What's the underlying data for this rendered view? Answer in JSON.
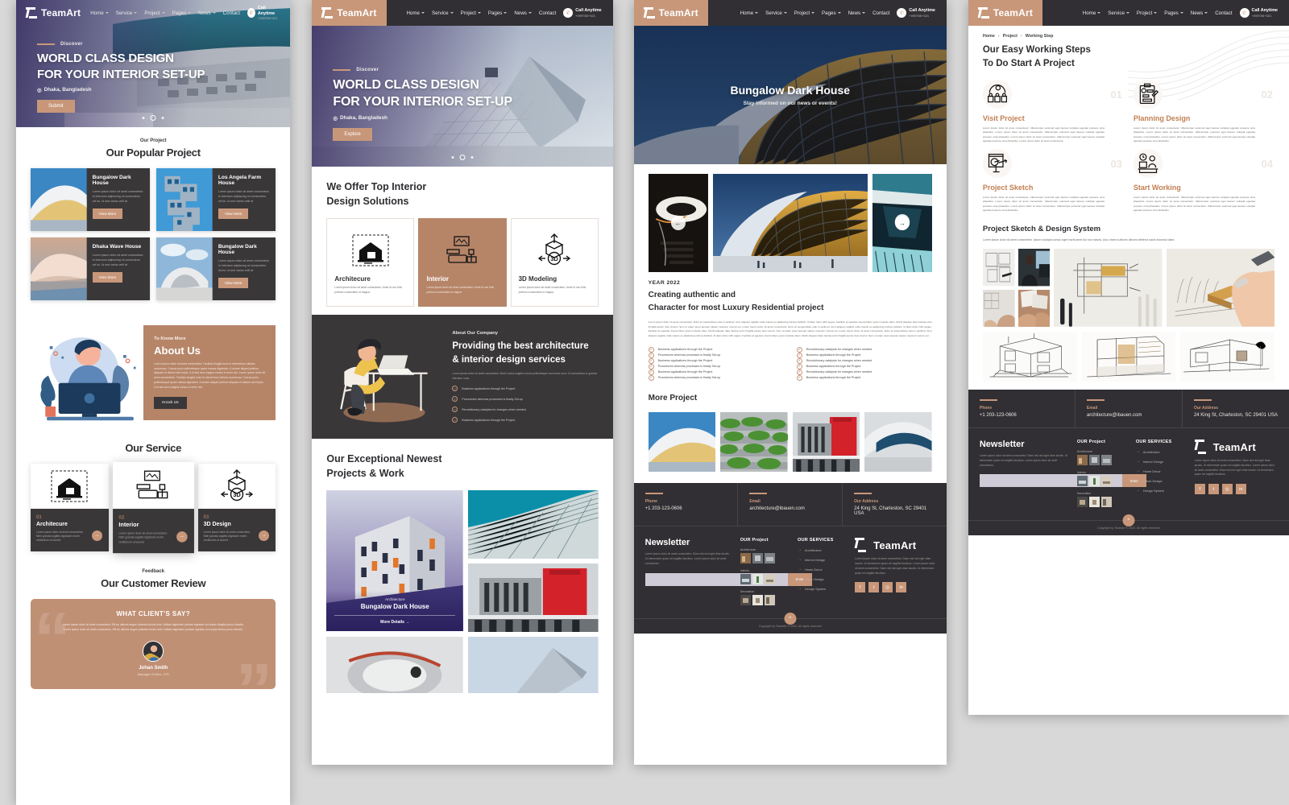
{
  "brand": {
    "name": "TeamArt",
    "accent": "#c8977a",
    "dark": "#312f33"
  },
  "nav": {
    "items": [
      {
        "label": "Home",
        "caret": true
      },
      {
        "label": "Service",
        "caret": true
      },
      {
        "label": "Project",
        "caret": true
      },
      {
        "label": "Pages",
        "caret": true
      },
      {
        "label": "News",
        "caret": true
      },
      {
        "label": "Contact",
        "caret": false
      }
    ],
    "call_label": "Call Anytime",
    "call_number": "+099765+321"
  },
  "hero": {
    "kicker": "Discover",
    "line1": "WORLD CLASS DESIGN",
    "line2": "FOR YOUR INTERIOR SET-UP",
    "location": "Dhaka, Bangladesh",
    "btn_submit": "Submit",
    "btn_explore": "Explore"
  },
  "page1": {
    "popular": {
      "kicker": "Our Project",
      "title": "Our Popular Project",
      "view_more": "View More",
      "cards": [
        {
          "title": "Bungalow Dark House",
          "desc": "Lorem ipsum dolor sit amet consectetur. In interdum adipiscing mi consectetur vel bu. Id sed varius velit at"
        },
        {
          "title": "Los Angela Farm House",
          "desc": "Lorem ipsum dolor sit amet consectetur. In interdum adipiscing mi consectetur vel bu. Id sed varius velit at"
        },
        {
          "title": "Dhaka Wave House",
          "desc": "Lorem ipsum dolor sit amet consectetur. In interdum adipiscing mi consectetur vel bu. Id sed varius velit at"
        },
        {
          "title": "Bungalow Dark House",
          "desc": "Lorem ipsum dolor sit amet consectetur. In interdum adipiscing mi consectetur vel bu. Id sed varius velit at"
        }
      ]
    },
    "about": {
      "kicker": "To Know More",
      "title": "About Us",
      "body": "Lorem ipsum dolor sit amet consectetur. Facilisis feugiat enim in elementum ultrices accumsan. Cursus proin pellentesque quam massa dignissim. A ornare aliquet pretium aliquam et dictum sed turpis. A id sed arcu magna cursus in enim nisi. Lorem ipsum dolor sit amet consectetur. Facilisis feugiat enim in elementum ultrices accumsan. Cursus proin pellentesque quam massa dignissim. A ornare aliquet pretium aliquam et dictum sed turpis. A id sed arcu magna cursus in enim nisi.",
      "btn": "Knock Us"
    },
    "service": {
      "title": "Our Service",
      "cards": [
        {
          "num": "01",
          "title": "Architecure",
          "desc": "Lorem ipsum dolor sit amet consectetur. Nibh gravida sagittis dignissim morbi vestibulum ut laoreet"
        },
        {
          "num": "02",
          "title": "Interior",
          "desc": "Lorem ipsum dolor sit amet consectetur. Nibh gravida sagittis dignissim morbi vestibulum ut laoreet"
        },
        {
          "num": "03",
          "title": "3D Design",
          "desc": "Lorem ipsum dolor sit amet consectetur. Nibh gravida sagittis dignissim morbi vestibulum ut laoreet"
        }
      ]
    },
    "review": {
      "kicker": "Feedback",
      "title": "Our Customer Review",
      "card_title": "WHAT CLIENT'S SAY?",
      "quote": "Lorem ipsum dolor sit amet consectetur. Elit ac ultrices augue pharetra lectus duis. Nullam dignissim pretium egestas non turpis fringilla purus lobortis. Lorem ipsum dolor sit amet consectetur. Elit ac ultrices augue pharetra lectus duis. Nullam dignissim pretium egestas non turpis lectus purus lobortis.",
      "name": "Johan Smith",
      "role": "Manager Of Alco. LTD"
    }
  },
  "page2": {
    "offers": {
      "title_l1": "We Offer Top Interior",
      "title_l2": "Design Solutions",
      "cards": [
        {
          "title": "Architecure",
          "desc": "Lorem ipsum dolor sit amet consectetur. Amet id non felis pretium consectetur id magna.",
          "active": false
        },
        {
          "title": "Interior",
          "desc": "Lorem ipsum dolor sit amet consectetur. Amet id non felis pretium consectetur id magna.",
          "active": true
        },
        {
          "title": "3D Modeling",
          "desc": "Lorem ipsum dolor sit amet consectetur. Amet id non felis pretium consectetur id magna.",
          "active": false
        }
      ]
    },
    "band": {
      "kicker": "About Our Company",
      "title_l1": "Providing the best architecture",
      "title_l2": "& interior design services",
      "body": "Lorem ipsum dolor sit amet consectetur. Morbi luctus sagittis cursus pellentesque commodo urna. Ut consectetur in gravida interdum nunc.",
      "bullets": [
        "Business applications through the Project",
        "Procedures whereas processes is finally Set-up",
        "Revolutionary catalysts for changes when needed",
        "Business applications through the Project"
      ]
    },
    "portfolio": {
      "title_l1": "Our Exceptional Newest",
      "title_l2": "Projects & Work",
      "feature_kicker": "Architecture",
      "feature_title": "Bungalow Dark House",
      "feature_cta": "More Details"
    }
  },
  "page3": {
    "hero_title": "Bungalow Dark House",
    "hero_sub": "Stay informed on our news or events!",
    "year": "YEAR 2022",
    "title_l1": "Creating authentic and",
    "title_l2": "Character for most Luxury Residential project",
    "body": "Lorem ipsum dolor sit amet consectetur. Enim at suspendisse odio in eleifend. Arcu aliquam sagittis nulla mauris eu adipiscing ultrices facilisis. Id diam dolor nibh augue. Facilisis at egestas viverra libero justo molestie diam. Morbi aliquam diam lacinia enim fringilla auctor duis viverra. Sem ut etiam amet aenean sapien nascetur viverra vel. Lorem ipsum dolor sit amet consectetur. Enim at suspendisse odio in eleifend. Arcu aliquam sagittis nulla mauris eu adipiscing ultrices facilisis. Id diam dolor nibh augue. Facilisis at egestas viverra libero justo molestie diam. Morbi aliquam diam lacinia enim fringilla auctor duis viverra. Sem ut etiam amet aenean sapien nascetur viverra vel. Lorem ipsum dolor sit amet consectetur. Enim at suspendisse odio in eleifend. Arcu aliquam sagittis nulla mauris eu adipiscing ultrices facilisis. Id diam dolor nibh augue. Facilisis at egestas viverra libero justo molestie diam. Morbi aliquam diam lacinia enim fringilla auctor duis viverra. Sem ut etiam amet aenean sapien nascetur viverra vel.",
    "bullets_left": [
      "Business applications through the Project",
      "Procedures whereas processes is finally Set-up",
      "Business applications through the Project",
      "Procedures whereas processes is finally Set-up",
      "Business applications through the Project",
      "Procedures whereas processes is finally Set-up"
    ],
    "bullets_right": [
      "Revolutionary catalysts for changes when needed",
      "Business applications through the Project",
      "Revolutionary catalysts for changes when needed",
      "Business applications through the Project",
      "Revolutionary catalysts for changes when needed",
      "Business applications through the Project"
    ],
    "more_title": "More Project"
  },
  "page4": {
    "breadcrumb": [
      "Home",
      "Project",
      "Working Step"
    ],
    "title_l1": "Our Easy Working Steps",
    "title_l2": "To Do Start A Project",
    "steps": [
      {
        "num": "01",
        "title": "Visit Project",
        "desc": "Lorem ipsum dolor sit amet consectetur. Ullamcorper euismod eget laoreet volutpat egestas posuere urna phasellus. Lorem ipsum dolor sit amet consectetur. Ullamcorper euismod eget laoreet volutpat egestas posuere urna phasellus. Lorem ipsum dolor sit amet consectetur. Ullamcorper euismod eget laoreet volutpat egestas posuere urna phasellus. Lorem ipsum dolor sit amet consectetur."
      },
      {
        "num": "02",
        "title": "Planning Design",
        "desc": "Lorem ipsum dolor sit amet consectetur. Ullamcorper euismod eget laoreet volutpat egestas posuere urna phasellus. Lorem ipsum dolor sit amet consectetur. Ullamcorper euismod eget laoreet volutpat egestas posuere urna phasellus. Lorem ipsum dolor sit amet consectetur. Ullamcorper euismod eget laoreet volutpat egestas posuere urna phasellus."
      },
      {
        "num": "03",
        "title": "Project Sketch",
        "desc": "Lorem ipsum dolor sit amet consectetur. Ullamcorper euismod eget laoreet volutpat egestas posuere urna phasellus. Lorem ipsum dolor sit amet consectetur. Ullamcorper euismod eget laoreet volutpat egestas posuere urna phasellus. Lorem ipsum dolor sit amet consectetur. Ullamcorper euismod eget laoreet volutpat egestas posuere urna phasellus."
      },
      {
        "num": "04",
        "title": "Start Working",
        "desc": "Lorem ipsum dolor sit amet consectetur. Ullamcorper euismod eget laoreet volutpat egestas posuere urna phasellus. Lorem ipsum dolor sit amet consectetur. Ullamcorper euismod eget laoreet volutpat egestas posuere urna phasellus. Lorem ipsum dolor sit amet consectetur. Ullamcorper euismod eget laoreet volutpat egestas posuere urna phasellus."
      }
    ],
    "sketch_title": "Project Sketch & Design System",
    "sketch_desc": "Lorem ipsum dolor sit amet consectetur. Ipsum volutpat cursus eget morbi amet dui non mauris. Arcu viverra ultrices ultrices eleifend sociis euismod diam."
  },
  "footer": {
    "contact": [
      {
        "key": "Phone",
        "value": "+1 203-123-0606"
      },
      {
        "key": "Email",
        "value": "architecture@ibauen.com"
      },
      {
        "key": "Our Address",
        "value": "24 King St, Charleston, SC 29401 USA"
      }
    ],
    "newsletter_title": "Newsletter",
    "newsletter_desc": "Lorem ipsum dolor sit amet consectetur. Diam nisl nisl eget vitae iaculis. Ut elementum quam vel sagittis faucibus. Lorem ipsum dolor sit amet consectetur.",
    "newsletter_btn": "Enter",
    "project_title": "OUR Project",
    "project_groups": [
      "Architecture",
      "Interior",
      "Decoration"
    ],
    "services_title": "OUR SERVICES",
    "services": [
      "Architecture",
      "Interior Design",
      "Home Decor",
      "Urban Design",
      "Design System"
    ],
    "brand_desc": "Lorem ipsum dolor sit amet consectetur. Diam nisl nisl eget vitae iaculis. Ut elementum quam vel sagittis faucibus. Lorem ipsum dolor sit amet consectetur. Diam nisl nisl eget vitae iaculis. Ut elementum quam vel sagittis faucibus.",
    "socials": [
      "f",
      "t",
      "o",
      "in"
    ],
    "copyright": "Copyright by TeamArt © 2022. All rights reserved"
  }
}
